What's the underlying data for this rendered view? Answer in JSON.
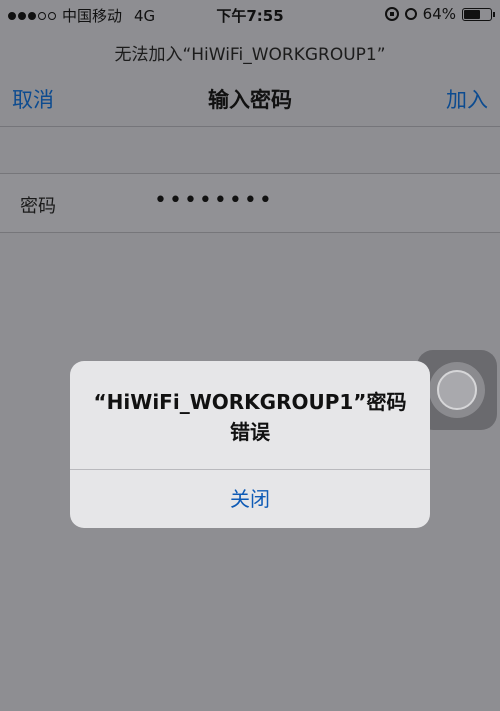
{
  "status_bar": {
    "carrier": "中国移动",
    "network": "4G",
    "time": "下午7:55",
    "battery": "64%",
    "battery_level": 0.64,
    "signal_bars_filled": 3,
    "signal_bars_total": 5
  },
  "subtitle": "无法加入“HiWiFi_WORKGROUP1”",
  "nav": {
    "cancel": "取消",
    "title": "输入密码",
    "join": "加入"
  },
  "password": {
    "label": "密码",
    "value": "••••••••"
  },
  "alert": {
    "message": "“HiWiFi_WORKGROUP1”密码错误",
    "close": "关闭"
  },
  "colors": {
    "link": "#0c4b90",
    "alert_button": "#0f5bb6",
    "dim_background": "#8e8e92"
  }
}
